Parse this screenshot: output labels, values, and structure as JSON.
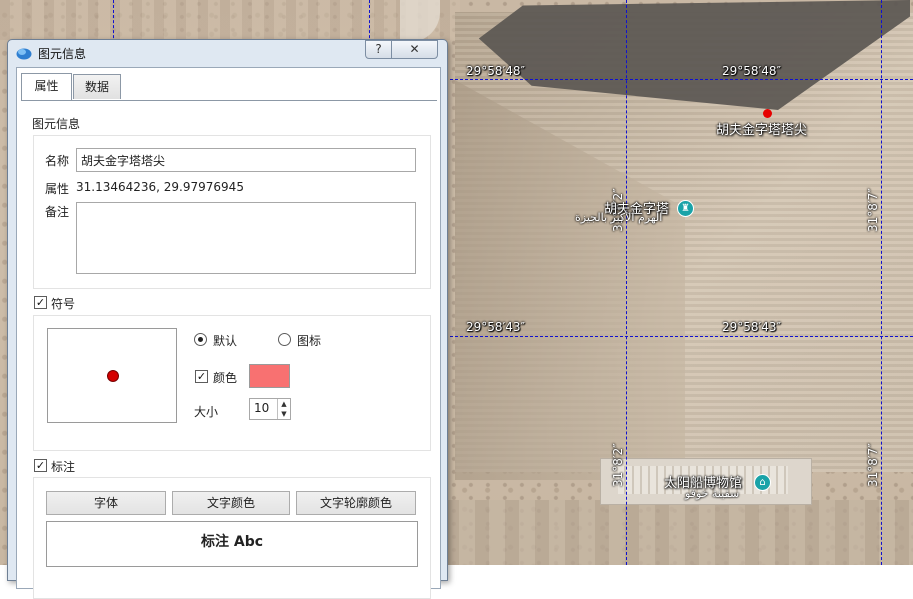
{
  "map": {
    "lat_labels": [
      "29°58′48″",
      "29°58′48″",
      "29°58′43″",
      "29°58′43″"
    ],
    "lon_labels": [
      "31°8′2″",
      "31°8′7″",
      "31°8′2″",
      "31°8′7″"
    ],
    "places": {
      "marker_name": "胡夫金字塔塔尖",
      "pyramid_zh": "胡夫金字塔",
      "pyramid_ar": "الهرم الأكبر بالجيزة",
      "museum_zh": "太阳船博物馆",
      "museum_ar": "سفينة خوفو"
    },
    "colors": {
      "grid": "#1010d0",
      "marker": "#e60000",
      "poi": "#1aa3a8"
    }
  },
  "dialog": {
    "title": "图元信息",
    "help_glyph": "?",
    "close_glyph": "✕",
    "tabs": [
      {
        "label": "属性",
        "active": true
      },
      {
        "label": "数据",
        "active": false
      }
    ],
    "info": {
      "section_title": "图元信息",
      "name_label": "名称",
      "name_value": "胡夫金字塔塔尖",
      "attr_label": "属性",
      "attr_value": "31.13464236, 29.97976945",
      "note_label": "备注",
      "note_value": ""
    },
    "symbol": {
      "enabled": true,
      "label": "符号",
      "radio_default": "默认",
      "radio_icon": "图标",
      "selected": "默认",
      "color_checked": true,
      "color_label": "颜色",
      "color_value": "#f87171",
      "size_label": "大小",
      "size_value": "10"
    },
    "annotation": {
      "enabled": true,
      "label": "标注",
      "font_button": "字体",
      "text_color_button": "文字颜色",
      "outline_color_button": "文字轮廓颜色",
      "preview_text": "标注 Abc"
    },
    "check_glyph": "✓"
  }
}
